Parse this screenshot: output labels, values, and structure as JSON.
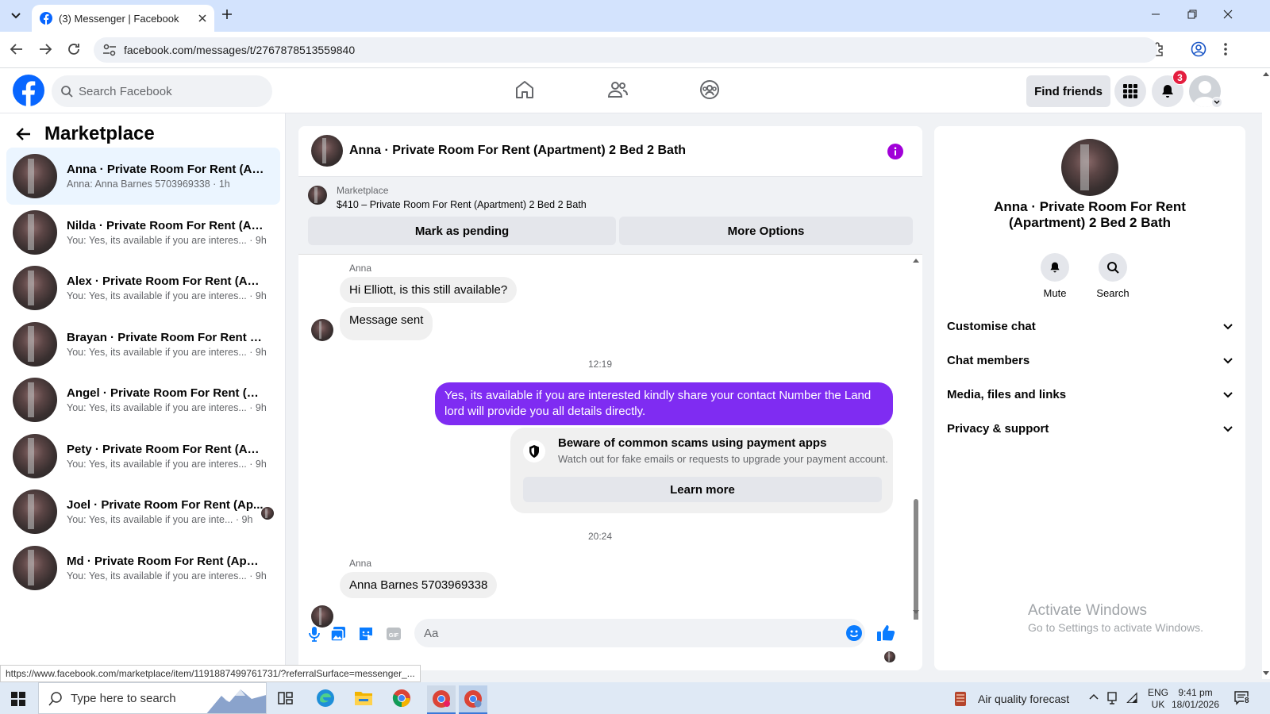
{
  "browser": {
    "tab_title": "(3) Messenger | Facebook",
    "url": "facebook.com/messages/t/2767878513559840",
    "status_url": "https://www.facebook.com/marketplace/item/1191887499761731/?referralSurface=messenger_..."
  },
  "fb_header": {
    "search_placeholder": "Search Facebook",
    "find_friends": "Find friends",
    "notif_count": "3"
  },
  "sidebar": {
    "title": "Marketplace",
    "conversations": [
      {
        "name": "Anna · Private Room For Rent (Apa...",
        "snippet": "Anna: Anna Barnes 5703969338 · 1h"
      },
      {
        "name": "Nilda · Private Room For Rent (Ap...",
        "snippet": "You: Yes, its available if you are interes... · 9h"
      },
      {
        "name": "Alex · Private Room For Rent (Apar...",
        "snippet": "You: Yes, its available if you are interes... · 9h"
      },
      {
        "name": "Brayan · Private Room For Rent (A...",
        "snippet": "You: Yes, its available if you are interes... · 9h"
      },
      {
        "name": "Angel · Private Room For Rent (Ap...",
        "snippet": "You: Yes, its available if you are interes... · 9h"
      },
      {
        "name": "Pety · Private Room For Rent (Apar...",
        "snippet": "You: Yes, its available if you are interes... · 9h"
      },
      {
        "name": "Joel · Private Room For Rent (Ap...",
        "snippet": "You: Yes, its available if you are inte... · 9h"
      },
      {
        "name": "Md · Private Room For Rent (Apart...",
        "snippet": "You: Yes, its available if you are interes... · 9h"
      }
    ]
  },
  "chat": {
    "title": "Anna · Private Room For Rent (Apartment) 2 Bed 2 Bath",
    "listing_label": "Marketplace",
    "listing_title": "$410 – Private Room For Rent (Apartment) 2 Bed 2 Bath",
    "mark_pending": "Mark as pending",
    "more_options": "More Options",
    "sender_name_1": "Anna",
    "msg1": "Hi Elliott, is this still available?",
    "msg2": "Message sent",
    "time1": "12:19",
    "outgoing": "Yes, its available if you are interested kindly share your contact Number the Land lord will provide you all details directly.",
    "scam_title": "Beware of common scams using payment apps",
    "scam_body": "Watch out for fake emails or requests to upgrade your payment account.",
    "learn_more": "Learn more",
    "time2": "20:24",
    "sender_name_2": "Anna",
    "msg3": "Anna Barnes 5703969338",
    "composer_placeholder": "Aa"
  },
  "details": {
    "name": "Anna · Private Room For Rent (Apartment) 2 Bed 2 Bath",
    "mute": "Mute",
    "search": "Search",
    "sections": [
      "Customise chat",
      "Chat members",
      "Media, files and links",
      "Privacy & support"
    ],
    "watermark_1": "Activate Windows",
    "watermark_2": "Go to Settings to activate Windows."
  },
  "taskbar": {
    "search_placeholder": "Type here to search",
    "weather": "Air quality forecast",
    "lang1": "ENG",
    "lang2": "UK",
    "time": "9:41 pm",
    "date": "18/01/2026",
    "notif": "8"
  },
  "colors": {
    "fb_blue": "#0866ff",
    "messenger_purple": "#7f2cf2",
    "like_blue": "#0a7cff"
  }
}
